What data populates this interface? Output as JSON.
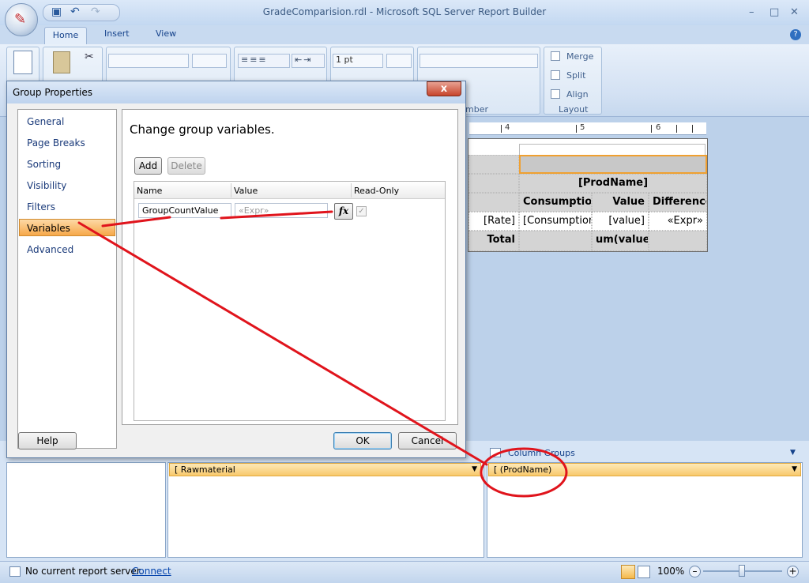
{
  "window": {
    "title": "GradeComparision.rdl - Microsoft SQL Server Report Builder"
  },
  "ribbon": {
    "tabs": [
      "Home",
      "Insert",
      "View"
    ],
    "font_size_value": "1 pt",
    "merge_label": "Merge",
    "split_label": "Split",
    "align_label": "Align",
    "layout_group_label": "Layout",
    "number_group_label": "mber"
  },
  "ruler": {
    "labels": [
      "4",
      "5",
      "6"
    ]
  },
  "tablix": {
    "header": "[ProdName]",
    "col_consumption": "Consumption",
    "col_value": "Value",
    "col_difference": "Difference",
    "rate": "[Rate]",
    "consumption_field": "[Consumption]",
    "value_field": "[value]",
    "expr": "«Expr»",
    "total": "Total",
    "sum_value": "um(value)]"
  },
  "groups": {
    "row_group": "Rawmaterial",
    "column_groups_label": "Column Groups",
    "column_group": "(ProdName)"
  },
  "status": {
    "server_text": "No current report server.",
    "connect_link": "Connect",
    "zoom": "100%"
  },
  "dialog": {
    "title": "Group Properties",
    "close": "x",
    "nav_items": [
      "General",
      "Page Breaks",
      "Sorting",
      "Visibility",
      "Filters",
      "Variables",
      "Advanced"
    ],
    "selected_nav": "Variables",
    "heading": "Change group variables.",
    "add_button": "Add",
    "delete_button": "Delete",
    "columns": [
      "Name",
      "Value",
      "Read-Only"
    ],
    "variable_name": "GroupCountValue",
    "variable_value_placeholder": "«Expr»",
    "fx_button": "fx",
    "help_button": "Help",
    "ok_button": "OK",
    "cancel_button": "Cancel"
  },
  "annotation": {
    "color": "#e0141c"
  }
}
